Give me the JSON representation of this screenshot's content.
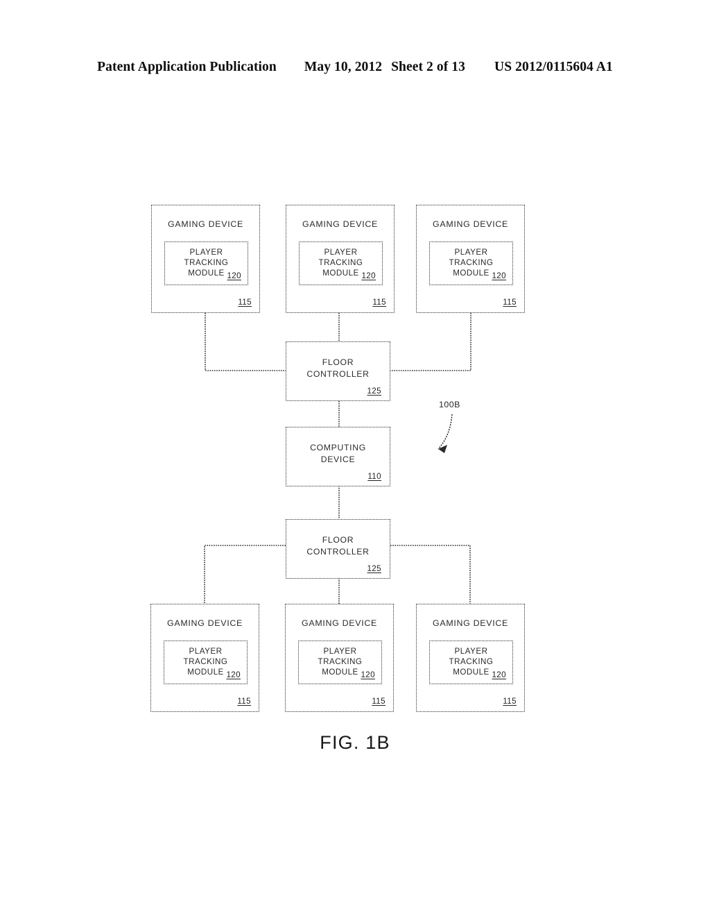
{
  "header": {
    "publication": "Patent Application Publication",
    "date": "May 10, 2012",
    "sheet": "Sheet 2 of 13",
    "patent_number": "US 2012/0115604 A1"
  },
  "figure": {
    "caption": "FIG. 1B",
    "system_label": "100B"
  },
  "labels": {
    "gaming_device": "GAMING DEVICE",
    "player_tracking_module_line1": "PLAYER",
    "player_tracking_module_line2": "TRACKING",
    "player_tracking_module_line3": "MODULE",
    "floor_controller_line1": "FLOOR",
    "floor_controller_line2": "CONTROLLER",
    "computing_device_line1": "COMPUTING",
    "computing_device_line2": "DEVICE"
  },
  "reference_numerals": {
    "gaming_device": "115",
    "player_tracking_module": "120",
    "floor_controller": "125",
    "computing_device": "110",
    "system": "100B"
  },
  "nodes": {
    "top_gaming_devices": [
      {
        "title": "GAMING DEVICE",
        "module_ref": "120",
        "device_ref": "115"
      },
      {
        "title": "GAMING DEVICE",
        "module_ref": "120",
        "device_ref": "115"
      },
      {
        "title": "GAMING DEVICE",
        "module_ref": "120",
        "device_ref": "115"
      }
    ],
    "bottom_gaming_devices": [
      {
        "title": "GAMING DEVICE",
        "module_ref": "120",
        "device_ref": "115"
      },
      {
        "title": "GAMING DEVICE",
        "module_ref": "120",
        "device_ref": "115"
      },
      {
        "title": "GAMING DEVICE",
        "module_ref": "120",
        "device_ref": "115"
      }
    ],
    "top_floor_controller": {
      "ref": "125"
    },
    "bottom_floor_controller": {
      "ref": "125"
    },
    "computing_device": {
      "ref": "110"
    }
  },
  "colors": {
    "line": "#2b2b2b",
    "text": "#1a1a1a",
    "background": "#ffffff"
  }
}
